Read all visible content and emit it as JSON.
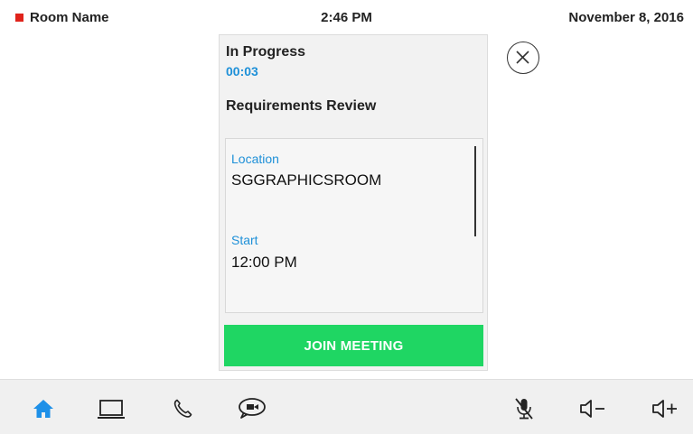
{
  "header": {
    "room_name": "Room Name",
    "time": "2:46 PM",
    "date": "November 8, 2016",
    "status_color": "#e0231b"
  },
  "meeting": {
    "status": "In Progress",
    "elapsed": "00:03",
    "subject": "Requirements Review",
    "details": {
      "location_label": "Location",
      "location_value": "SGGRAPHICSROOM",
      "start_label": "Start",
      "start_value": "12:00 PM"
    },
    "join_label": "JOIN MEETING",
    "join_color": "#1fd663",
    "accent_color": "#1e90d8"
  },
  "close_button": {
    "icon": "close-icon"
  },
  "bottom_bar": {
    "items": [
      {
        "icon": "home-icon",
        "active": true
      },
      {
        "icon": "laptop-icon",
        "active": false
      },
      {
        "icon": "phone-icon",
        "active": false
      },
      {
        "icon": "video-chat-icon",
        "active": false
      },
      {
        "icon": "mic-muted-icon",
        "active": false
      },
      {
        "icon": "volume-down-icon",
        "active": false
      },
      {
        "icon": "volume-up-icon",
        "active": false
      }
    ]
  }
}
